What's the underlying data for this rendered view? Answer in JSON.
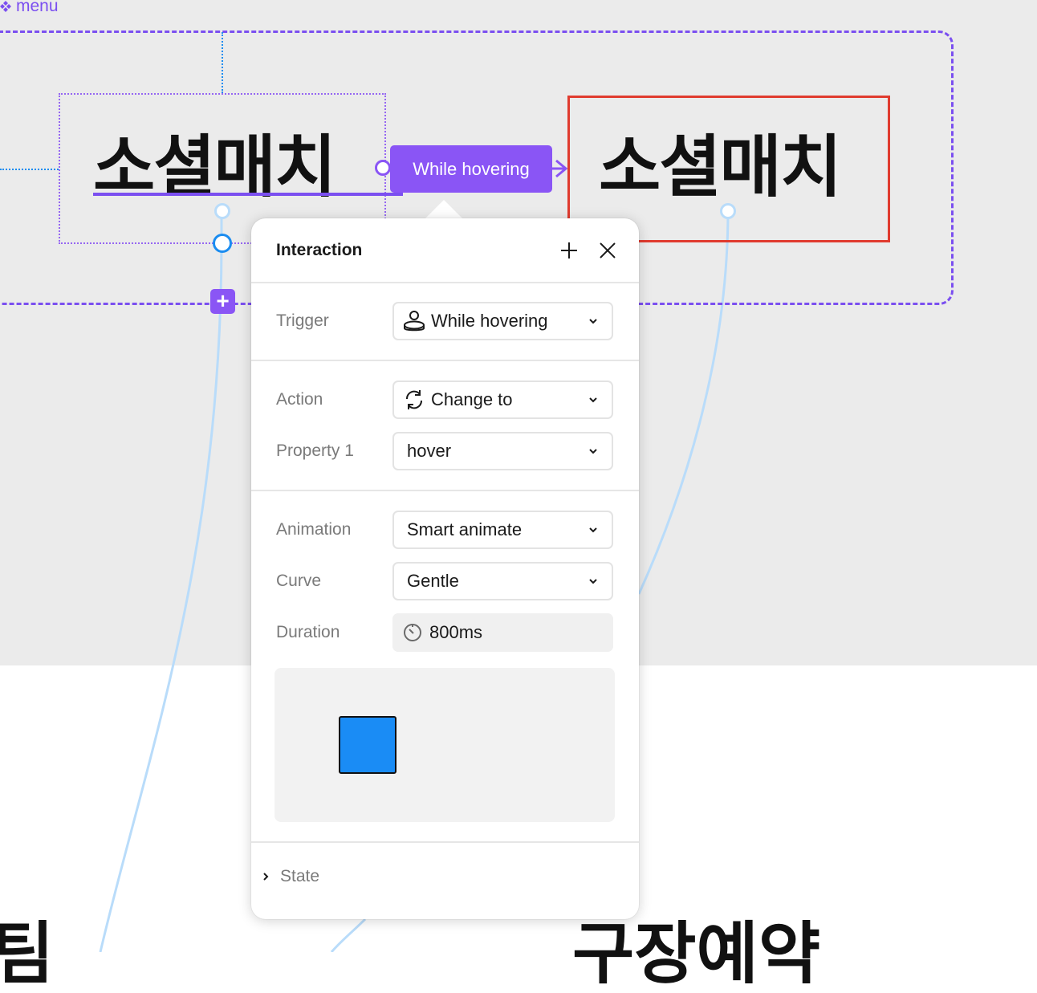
{
  "canvas": {
    "component_label": "menu",
    "variant_default_text": "소셜매치",
    "variant_hover_text": "소셜매치",
    "connector_label": "While hovering",
    "bottom_left_text": "팀",
    "bottom_right_text": "구장예약"
  },
  "panel": {
    "title": "Interaction",
    "add_icon": "plus-icon",
    "close_icon": "close-icon",
    "trigger": {
      "label": "Trigger",
      "value": "While hovering",
      "icon": "hover-icon"
    },
    "action": {
      "label": "Action",
      "value": "Change to",
      "icon": "swap-icon"
    },
    "property": {
      "label": "Property 1",
      "value": "hover"
    },
    "animation": {
      "label": "Animation",
      "value": "Smart animate"
    },
    "curve": {
      "label": "Curve",
      "value": "Gentle"
    },
    "duration": {
      "label": "Duration",
      "value": "800ms",
      "icon": "timer-icon"
    },
    "state_label": "State"
  },
  "colors": {
    "accent": "#8a55f5",
    "selection_red": "#e03b2f",
    "preview_square": "#1a8cf5",
    "wire": "#b9dcfa"
  }
}
